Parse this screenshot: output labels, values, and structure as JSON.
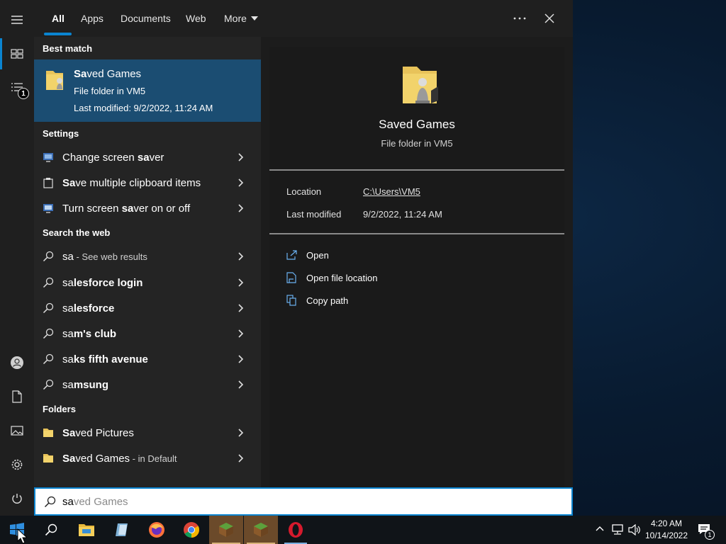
{
  "tabs": [
    "All",
    "Apps",
    "Documents",
    "Web",
    "More"
  ],
  "best_match": {
    "heading": "Best match",
    "title_bold": "Sa",
    "title_rest": "ved Games",
    "line1": "File folder in VM5",
    "line2": "Last modified: 9/2/2022, 11:24 AM"
  },
  "settings": {
    "heading": "Settings",
    "items": [
      {
        "pre": "Change screen ",
        "bold": "sa",
        "post": "ver"
      },
      {
        "pre": "",
        "bold": "Sa",
        "post": "ve multiple clipboard items"
      },
      {
        "pre": "Turn screen ",
        "bold": "sa",
        "post": "ver on or off"
      }
    ]
  },
  "web": {
    "heading": "Search the web",
    "first": {
      "query": "sa",
      "suffix": " - See web results"
    },
    "items": [
      {
        "bold": "sa",
        "rest": "lesforce login"
      },
      {
        "bold": "sa",
        "rest": "lesforce"
      },
      {
        "bold": "sa",
        "rest": "m's club"
      },
      {
        "bold": "sa",
        "rest": "ks fifth avenue"
      },
      {
        "bold": "sa",
        "rest": "msung"
      }
    ]
  },
  "folders": {
    "heading": "Folders",
    "items": [
      {
        "bold": "Sa",
        "rest": "ved Pictures",
        "suffix": ""
      },
      {
        "bold": "Sa",
        "rest": "ved Games",
        "suffix": " - in Default"
      }
    ]
  },
  "preview": {
    "title": "Saved Games",
    "subtitle": "File folder in VM5",
    "location_label": "Location",
    "location_value": "C:\\Users\\VM5",
    "modified_label": "Last modified",
    "modified_value": "9/2/2022, 11:24 AM",
    "actions": [
      "Open",
      "Open file location",
      "Copy path"
    ]
  },
  "search": {
    "typed": "sa",
    "completion": "ved Games"
  },
  "left_rail": {
    "notification_count": "1"
  },
  "taskbar": {
    "time": "4:20 AM",
    "date": "10/14/2022",
    "notification_count": "1"
  },
  "colors": {
    "accent": "#0a84d0",
    "selection": "#1b4d72"
  }
}
